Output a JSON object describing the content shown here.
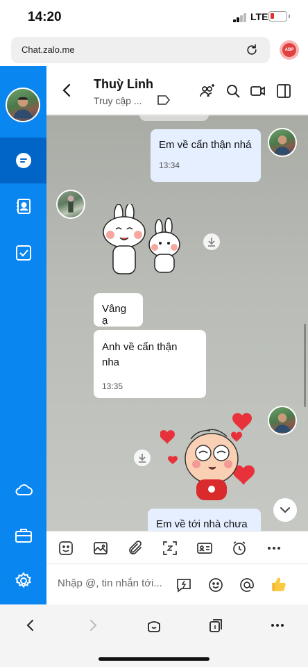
{
  "status_bar": {
    "time": "14:20",
    "network": "LTE"
  },
  "browser": {
    "url": "Chat.zalo.me",
    "adblock_label": "ABP"
  },
  "chat_header": {
    "name": "Thuỳ Linh",
    "status": "Truy cập ..."
  },
  "messages": [
    {
      "side": "me",
      "text": "Em về cẩn thận nhá",
      "time": "13:34"
    },
    {
      "side": "them",
      "type": "sticker",
      "sticker": "bunny-sticker"
    },
    {
      "side": "them",
      "text": "Vâng ạ"
    },
    {
      "side": "them",
      "text": "Anh về cẩn thận nha",
      "time": "13:35"
    },
    {
      "side": "me",
      "type": "sticker",
      "sticker": "hearts-boy-sticker"
    },
    {
      "side": "me",
      "text": "Em về tới nhà chưa"
    }
  ],
  "input": {
    "placeholder": "Nhập @, tin nhắn tới..."
  },
  "colors": {
    "sidebar": "#0a86f0",
    "sidebar_active": "#0065c7",
    "bubble_me": "#e5efff",
    "bubble_them": "#ffffff"
  }
}
